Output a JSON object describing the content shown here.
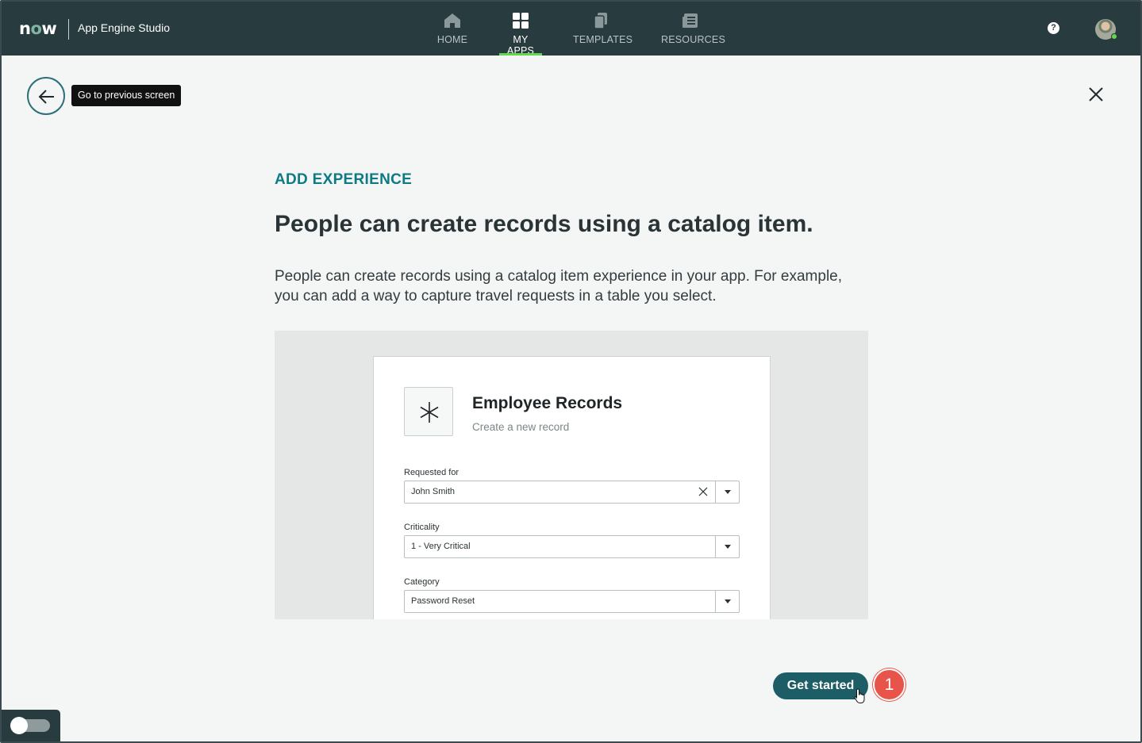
{
  "brand": {
    "logo": "now",
    "app_name": "App Engine Studio"
  },
  "nav": [
    {
      "label": "HOME",
      "icon": "home-icon",
      "active": false
    },
    {
      "label": "MY APPS",
      "icon": "grid-icon",
      "active": true
    },
    {
      "label": "TEMPLATES",
      "icon": "templates-icon",
      "active": false
    },
    {
      "label": "RESOURCES",
      "icon": "resources-icon",
      "active": false
    }
  ],
  "header_right": {
    "help_icon": "?"
  },
  "back": {
    "tooltip": "Go to previous screen"
  },
  "content": {
    "eyebrow": "ADD EXPERIENCE",
    "headline": "People can create records using a catalog item.",
    "description": "People can create records using a catalog item experience in your app. For example, you can add a way to capture travel requests in a table you select."
  },
  "preview": {
    "title": "Employee Records",
    "subtitle": "Create a new record",
    "fields": [
      {
        "label": "Requested for",
        "value": "John Smith",
        "clearable": true
      },
      {
        "label": "Criticality",
        "value": "1 - Very Critical",
        "clearable": false
      },
      {
        "label": "Category",
        "value": "Password Reset",
        "clearable": false
      }
    ]
  },
  "cta": {
    "label": "Get started"
  },
  "step_badge": "1",
  "colors": {
    "topbar": "#283b3e",
    "accent": "#0d7a84",
    "button": "#1d5d66",
    "badge": "#e8544a",
    "active_tab": "#62d84e"
  }
}
